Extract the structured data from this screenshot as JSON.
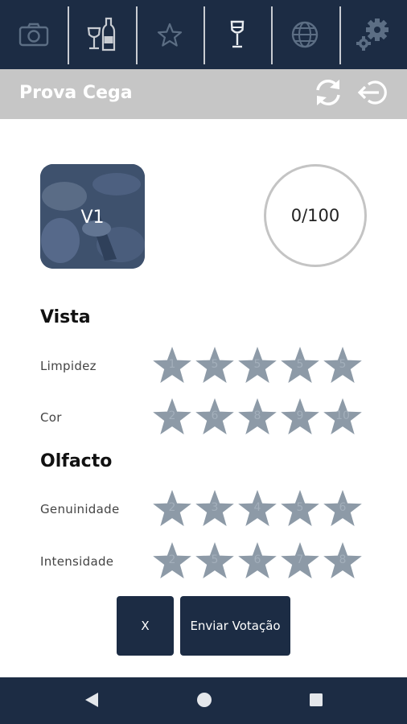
{
  "top_nav": {
    "items": [
      {
        "icon": "camera-icon"
      },
      {
        "icon": "wine-bottle-glass-icon"
      },
      {
        "icon": "star-outline-icon"
      },
      {
        "icon": "wine-glass-icon"
      },
      {
        "icon": "globe-icon"
      },
      {
        "icon": "gears-icon"
      }
    ]
  },
  "title_bar": {
    "title": "Prova Cega",
    "refresh_icon": "refresh-icon",
    "logout_icon": "logout-icon"
  },
  "sample": {
    "label": "V1",
    "score": "0/100"
  },
  "sections": [
    {
      "title": "Vista",
      "criteria": [
        {
          "label": "Limpidez",
          "stars": [
            "1",
            "5",
            "5",
            "5",
            "5"
          ]
        },
        {
          "label": "Cor",
          "stars": [
            "2",
            "6",
            "8",
            "9",
            "10"
          ]
        }
      ]
    },
    {
      "title": "Olfacto",
      "criteria": [
        {
          "label": "Genuinidade",
          "stars": [
            "2",
            "3",
            "4",
            "5",
            "6"
          ]
        },
        {
          "label": "Intensidade",
          "stars": [
            "2",
            "5",
            "6",
            "7",
            "8"
          ]
        }
      ]
    }
  ],
  "actions": {
    "cancel_label": "X",
    "submit_label": "Enviar Votação"
  },
  "colors": {
    "primary": "#1c2c44",
    "title_bar": "#c6c6c6",
    "star": "#8d9aa7",
    "star_number": "#a3afbb"
  },
  "system_nav": {
    "back_icon": "back-triangle-icon",
    "home_icon": "home-circle-icon",
    "recents_icon": "recents-square-icon"
  }
}
